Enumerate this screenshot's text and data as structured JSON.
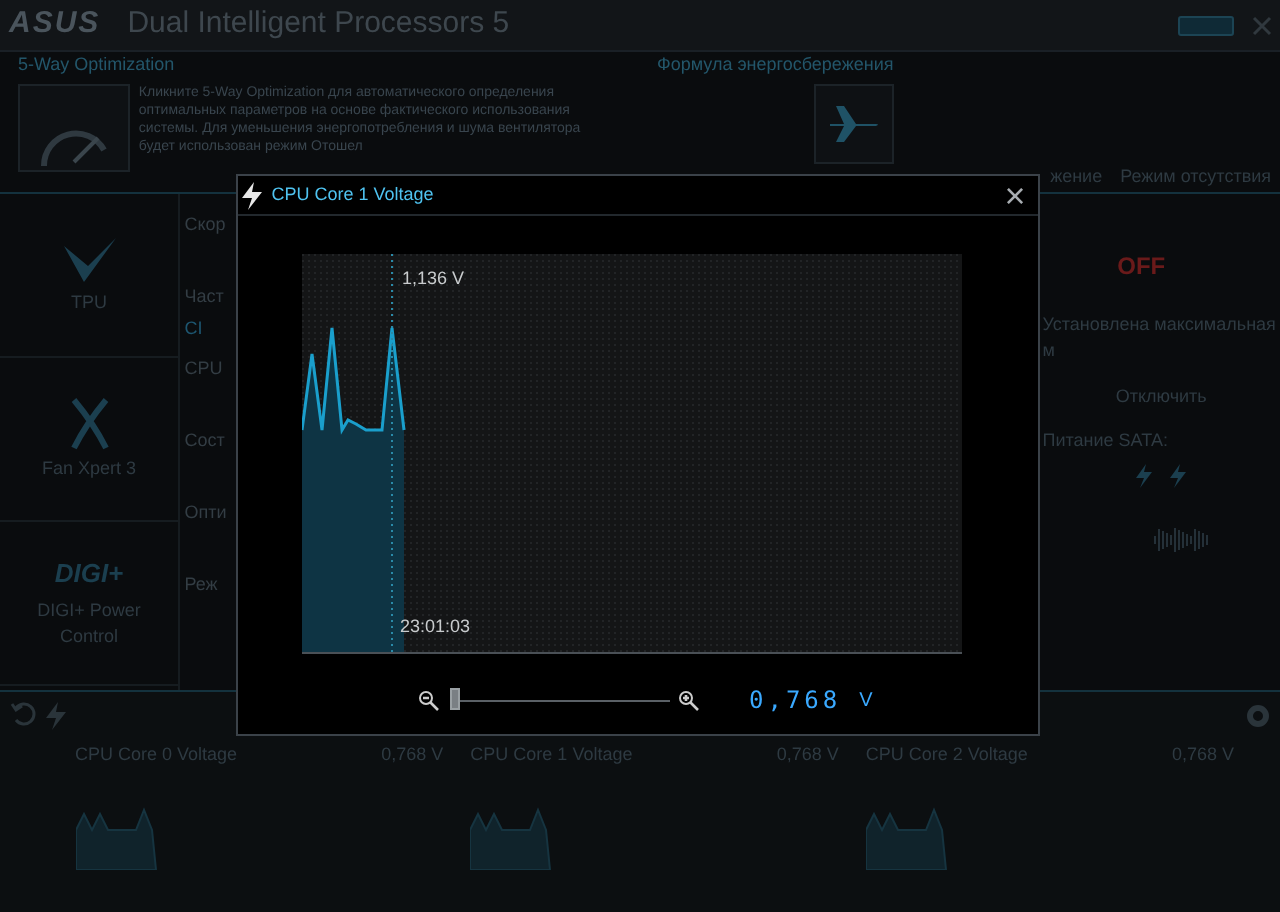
{
  "app": {
    "logo": "ASUS",
    "title": "Dual Intelligent Processors 5"
  },
  "optimization": {
    "title": "5-Way Optimization",
    "description": "Кликните 5-Way Optimization для автоматического определения оптимальных параметров на основе фактического использования системы. Для уменьшения энергопотребления и шума вентилятора будет использован режим Отошел"
  },
  "power_formula": {
    "title": "Формула энергосбережения",
    "modes": [
      "жение",
      "Режим отсутствия"
    ]
  },
  "sidebar": {
    "items": [
      {
        "kind": "tpu",
        "label": "TPU"
      },
      {
        "kind": "fan",
        "label": "Fan Xpert 3"
      },
      {
        "kind": "digi",
        "logo": "DIGI+",
        "label": "DIGI+ Power Control"
      }
    ]
  },
  "settings": {
    "rows": [
      {
        "label": "Скор"
      },
      {
        "label": "Част",
        "value": "CI"
      },
      {
        "label": "CPU"
      },
      {
        "label": "Сост"
      },
      {
        "label": "Опти"
      },
      {
        "label": "Реж"
      }
    ]
  },
  "right_panel": {
    "status": "OFF",
    "note": "Установлена максимальная м",
    "action": "Отключить",
    "sata_label": "Питание SATA:"
  },
  "monitors": [
    {
      "name": "CPU Core 0 Voltage",
      "value": "0,768 V"
    },
    {
      "name": "CPU Core 1 Voltage",
      "value": "0,768 V"
    },
    {
      "name": "CPU Core 2 Voltage",
      "value": "0,768 V"
    }
  ],
  "dialog": {
    "title": "CPU Core 1 Voltage",
    "close": "×",
    "peak_label": "1,136 V",
    "time_label": "23:01:03",
    "zoom": {
      "level": 0
    },
    "reading": "0,768",
    "unit": "V"
  }
}
